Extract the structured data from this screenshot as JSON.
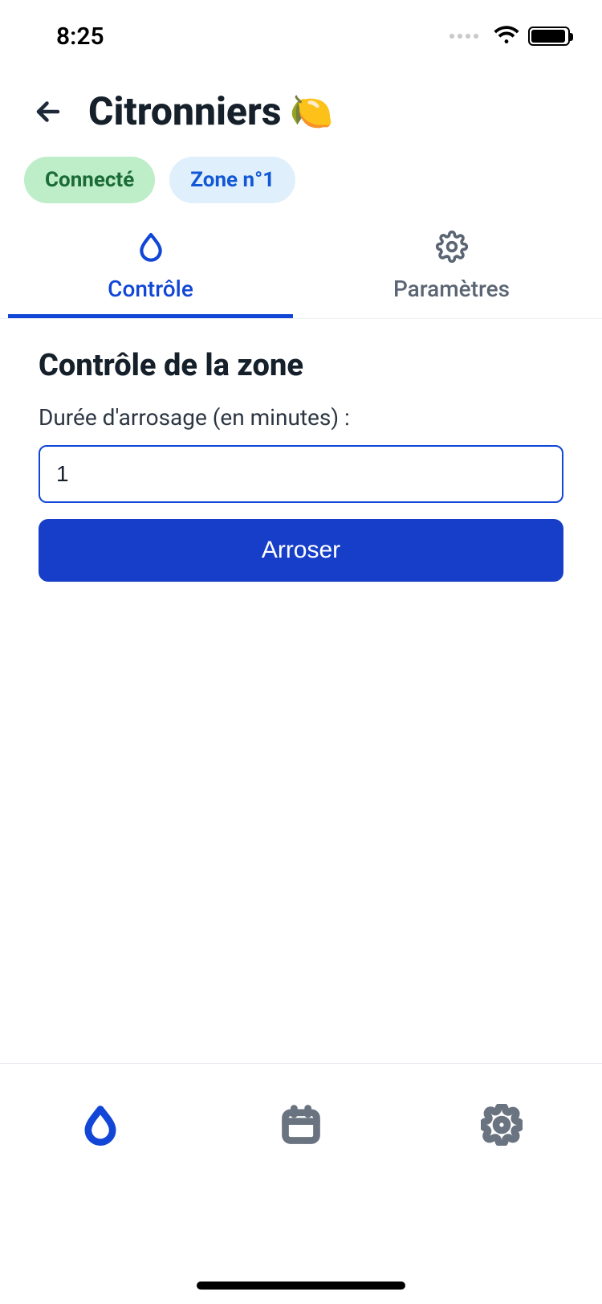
{
  "status": {
    "time": "8:25"
  },
  "header": {
    "title": "Citronniers",
    "emoji": "🍋"
  },
  "badges": {
    "connected": "Connecté",
    "zone": "Zone n°1"
  },
  "tabs": {
    "control": "Contrôle",
    "settings": "Paramètres"
  },
  "section": {
    "heading": "Contrôle de la zone",
    "durationLabel": "Durée d'arrosage (en minutes) :",
    "durationValue": "1",
    "waterButton": "Arroser"
  },
  "colors": {
    "primary": "#173ec9",
    "accent": "#1146d6",
    "badgeGreenBg": "#bdeec7",
    "badgeGreenFg": "#1b6b36",
    "badgeBlueBg": "#dff0fc",
    "badgeBlueFg": "#1157d6"
  }
}
